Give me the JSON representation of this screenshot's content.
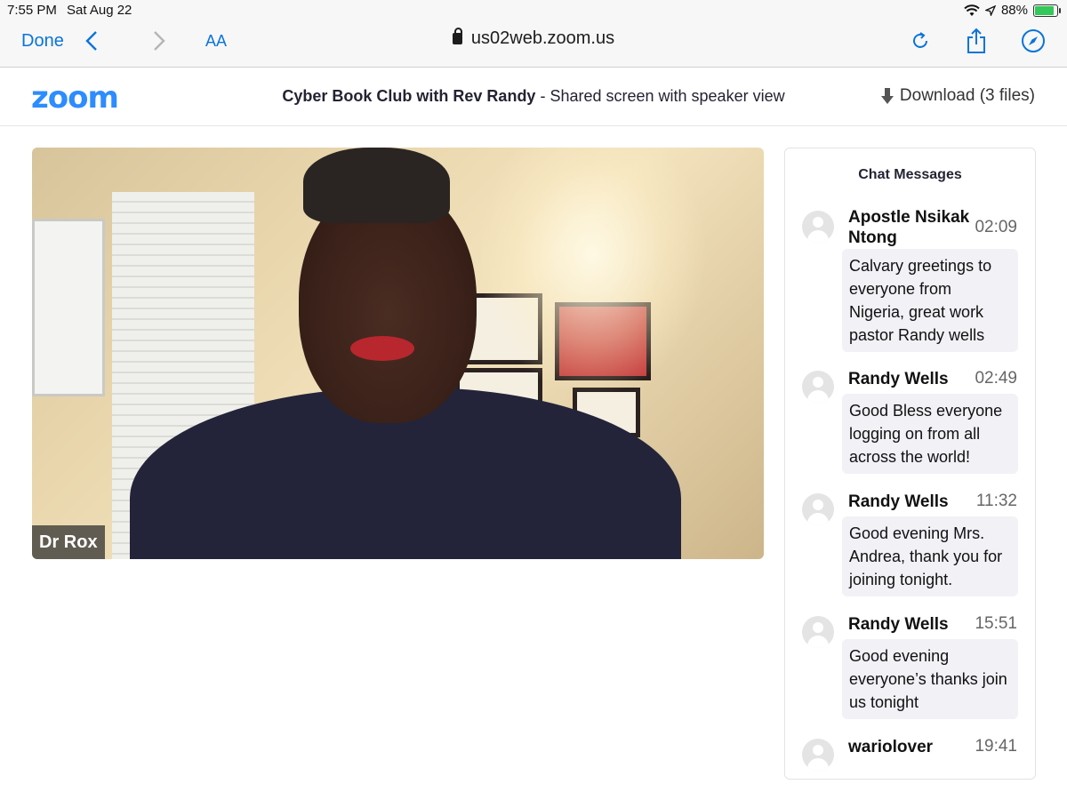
{
  "status_bar": {
    "time": "7:55 PM",
    "date": "Sat Aug 22",
    "battery": "88%",
    "battery_level": 0.88
  },
  "browser": {
    "done_label": "Done",
    "text_size_label": "AA",
    "url": "us02web.zoom.us"
  },
  "zoom": {
    "logo": "zoom",
    "meeting_title": "Cyber Book Club with Rev Randy",
    "meeting_subtitle": " - Shared screen with speaker view",
    "download_label": "Download (3 files)"
  },
  "video": {
    "speaker_name": "Dr Rox"
  },
  "chat": {
    "title": "Chat Messages",
    "messages": [
      {
        "sender": "Apostle Nsikak Ntong",
        "time": "02:09",
        "text": "Calvary greetings to everyone from Nigeria, great work pastor Randy wells"
      },
      {
        "sender": "Randy Wells",
        "time": "02:49",
        "text": "Good Bless everyone logging on from all across the world!"
      },
      {
        "sender": "Randy Wells",
        "time": "11:32",
        "text": "Good evening Mrs. Andrea, thank you for joining tonight."
      },
      {
        "sender": "Randy Wells",
        "time": "15:51",
        "text": "Good evening everyone’s thanks join us tonight"
      },
      {
        "sender": "wariolover",
        "time": "19:41",
        "text": ""
      }
    ]
  },
  "colors": {
    "accent": "#0a74da",
    "zoom_blue": "#2d8cff",
    "bubble": "#f1f1f6"
  }
}
